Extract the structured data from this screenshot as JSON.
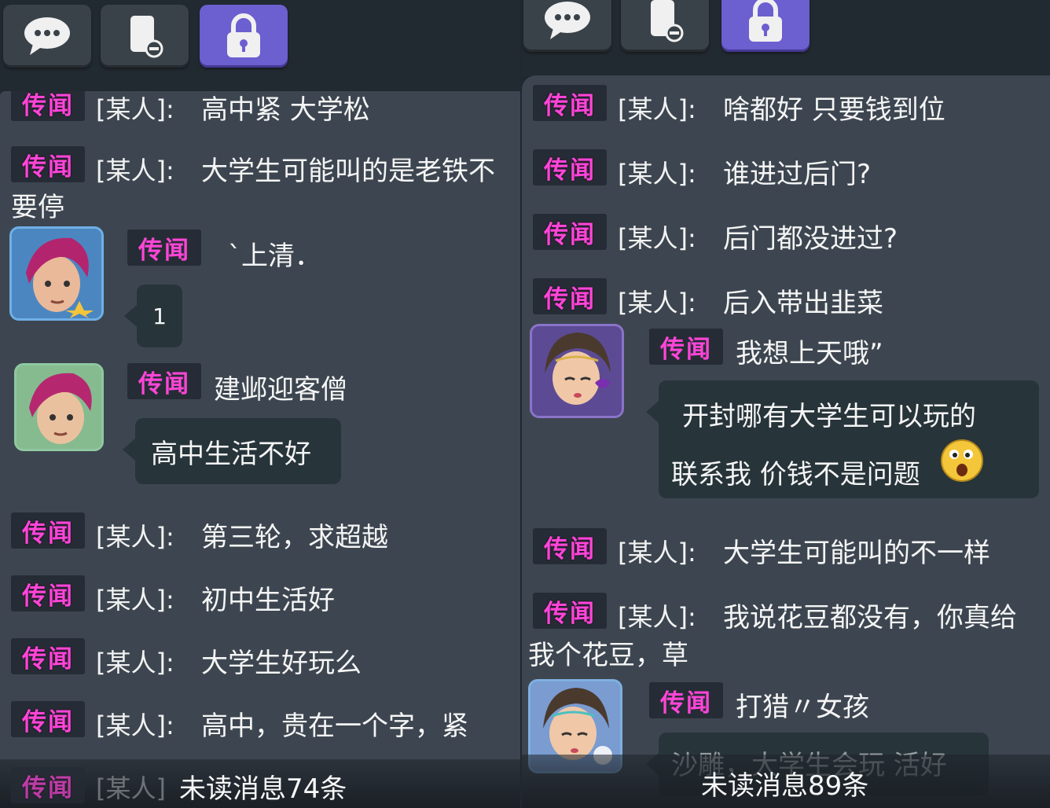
{
  "left": {
    "tabs": [
      {
        "icon": "chat-bubble-icon",
        "active": false
      },
      {
        "icon": "contacts-icon",
        "active": false
      },
      {
        "icon": "lock-icon",
        "active": true
      }
    ],
    "badge_label": "传闻",
    "sender_label": "[某人]:",
    "messages": [
      {
        "text": "高中紧 大学松"
      },
      {
        "text": "大学生可能叫的是老铁不",
        "cont": "要停"
      },
      {
        "text": "第三轮，求超越"
      },
      {
        "text": "初中生活好"
      },
      {
        "text": "大学生好玩么"
      },
      {
        "text": "高中，贵在一个字，紧"
      }
    ],
    "player_posts": [
      {
        "nickname": "`上清．",
        "bubble": "1"
      },
      {
        "nickname": "建邺迎客僧",
        "bubble": "高中生活不好"
      }
    ],
    "footer": {
      "sender_prefix": "[某人]",
      "unread": "未读消息74条"
    }
  },
  "right": {
    "tabs": [
      {
        "icon": "chat-bubble-icon",
        "active": false
      },
      {
        "icon": "contacts-icon",
        "active": false
      },
      {
        "icon": "lock-icon",
        "active": true
      }
    ],
    "badge_label": "传闻",
    "sender_label": "[某人]:",
    "messages_top": [
      {
        "text": "啥都好 只要钱到位"
      },
      {
        "text": "谁进过后门?"
      },
      {
        "text": "后门都没进过?"
      },
      {
        "text": "后入带出韭菜"
      }
    ],
    "player_post_1": {
      "nickname": "我想上天哦”",
      "bubble_line1": "开封哪有大学生可以玩的",
      "bubble_line2": "联系我 价钱不是问题"
    },
    "messages_bottom": [
      {
        "text": "大学生可能叫的不一样"
      },
      {
        "text": "我说花豆都没有，你真给",
        "cont": "我个花豆，草"
      }
    ],
    "player_post_2": {
      "nickname": "打猎〃女孩",
      "bubble_partial": "沙雕，大学生会玩 活好"
    },
    "footer": {
      "unread": "未读消息89条"
    }
  }
}
